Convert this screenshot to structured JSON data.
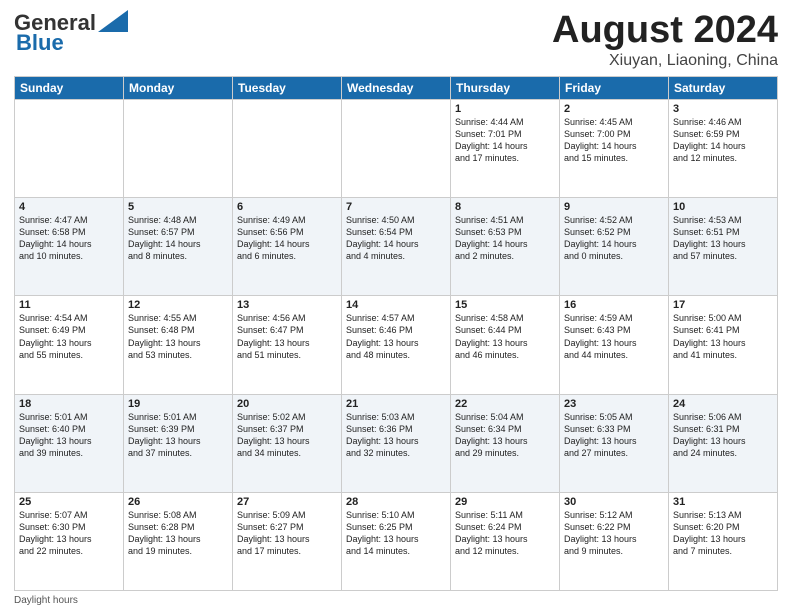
{
  "header": {
    "logo_line1": "General",
    "logo_line2": "Blue",
    "month": "August 2024",
    "location": "Xiuyan, Liaoning, China"
  },
  "days_of_week": [
    "Sunday",
    "Monday",
    "Tuesday",
    "Wednesday",
    "Thursday",
    "Friday",
    "Saturday"
  ],
  "weeks": [
    [
      {
        "day": "",
        "info": ""
      },
      {
        "day": "",
        "info": ""
      },
      {
        "day": "",
        "info": ""
      },
      {
        "day": "",
        "info": ""
      },
      {
        "day": "1",
        "info": "Sunrise: 4:44 AM\nSunset: 7:01 PM\nDaylight: 14 hours\nand 17 minutes."
      },
      {
        "day": "2",
        "info": "Sunrise: 4:45 AM\nSunset: 7:00 PM\nDaylight: 14 hours\nand 15 minutes."
      },
      {
        "day": "3",
        "info": "Sunrise: 4:46 AM\nSunset: 6:59 PM\nDaylight: 14 hours\nand 12 minutes."
      }
    ],
    [
      {
        "day": "4",
        "info": "Sunrise: 4:47 AM\nSunset: 6:58 PM\nDaylight: 14 hours\nand 10 minutes."
      },
      {
        "day": "5",
        "info": "Sunrise: 4:48 AM\nSunset: 6:57 PM\nDaylight: 14 hours\nand 8 minutes."
      },
      {
        "day": "6",
        "info": "Sunrise: 4:49 AM\nSunset: 6:56 PM\nDaylight: 14 hours\nand 6 minutes."
      },
      {
        "day": "7",
        "info": "Sunrise: 4:50 AM\nSunset: 6:54 PM\nDaylight: 14 hours\nand 4 minutes."
      },
      {
        "day": "8",
        "info": "Sunrise: 4:51 AM\nSunset: 6:53 PM\nDaylight: 14 hours\nand 2 minutes."
      },
      {
        "day": "9",
        "info": "Sunrise: 4:52 AM\nSunset: 6:52 PM\nDaylight: 14 hours\nand 0 minutes."
      },
      {
        "day": "10",
        "info": "Sunrise: 4:53 AM\nSunset: 6:51 PM\nDaylight: 13 hours\nand 57 minutes."
      }
    ],
    [
      {
        "day": "11",
        "info": "Sunrise: 4:54 AM\nSunset: 6:49 PM\nDaylight: 13 hours\nand 55 minutes."
      },
      {
        "day": "12",
        "info": "Sunrise: 4:55 AM\nSunset: 6:48 PM\nDaylight: 13 hours\nand 53 minutes."
      },
      {
        "day": "13",
        "info": "Sunrise: 4:56 AM\nSunset: 6:47 PM\nDaylight: 13 hours\nand 51 minutes."
      },
      {
        "day": "14",
        "info": "Sunrise: 4:57 AM\nSunset: 6:46 PM\nDaylight: 13 hours\nand 48 minutes."
      },
      {
        "day": "15",
        "info": "Sunrise: 4:58 AM\nSunset: 6:44 PM\nDaylight: 13 hours\nand 46 minutes."
      },
      {
        "day": "16",
        "info": "Sunrise: 4:59 AM\nSunset: 6:43 PM\nDaylight: 13 hours\nand 44 minutes."
      },
      {
        "day": "17",
        "info": "Sunrise: 5:00 AM\nSunset: 6:41 PM\nDaylight: 13 hours\nand 41 minutes."
      }
    ],
    [
      {
        "day": "18",
        "info": "Sunrise: 5:01 AM\nSunset: 6:40 PM\nDaylight: 13 hours\nand 39 minutes."
      },
      {
        "day": "19",
        "info": "Sunrise: 5:01 AM\nSunset: 6:39 PM\nDaylight: 13 hours\nand 37 minutes."
      },
      {
        "day": "20",
        "info": "Sunrise: 5:02 AM\nSunset: 6:37 PM\nDaylight: 13 hours\nand 34 minutes."
      },
      {
        "day": "21",
        "info": "Sunrise: 5:03 AM\nSunset: 6:36 PM\nDaylight: 13 hours\nand 32 minutes."
      },
      {
        "day": "22",
        "info": "Sunrise: 5:04 AM\nSunset: 6:34 PM\nDaylight: 13 hours\nand 29 minutes."
      },
      {
        "day": "23",
        "info": "Sunrise: 5:05 AM\nSunset: 6:33 PM\nDaylight: 13 hours\nand 27 minutes."
      },
      {
        "day": "24",
        "info": "Sunrise: 5:06 AM\nSunset: 6:31 PM\nDaylight: 13 hours\nand 24 minutes."
      }
    ],
    [
      {
        "day": "25",
        "info": "Sunrise: 5:07 AM\nSunset: 6:30 PM\nDaylight: 13 hours\nand 22 minutes."
      },
      {
        "day": "26",
        "info": "Sunrise: 5:08 AM\nSunset: 6:28 PM\nDaylight: 13 hours\nand 19 minutes."
      },
      {
        "day": "27",
        "info": "Sunrise: 5:09 AM\nSunset: 6:27 PM\nDaylight: 13 hours\nand 17 minutes."
      },
      {
        "day": "28",
        "info": "Sunrise: 5:10 AM\nSunset: 6:25 PM\nDaylight: 13 hours\nand 14 minutes."
      },
      {
        "day": "29",
        "info": "Sunrise: 5:11 AM\nSunset: 6:24 PM\nDaylight: 13 hours\nand 12 minutes."
      },
      {
        "day": "30",
        "info": "Sunrise: 5:12 AM\nSunset: 6:22 PM\nDaylight: 13 hours\nand 9 minutes."
      },
      {
        "day": "31",
        "info": "Sunrise: 5:13 AM\nSunset: 6:20 PM\nDaylight: 13 hours\nand 7 minutes."
      }
    ]
  ],
  "footer": "Daylight hours"
}
